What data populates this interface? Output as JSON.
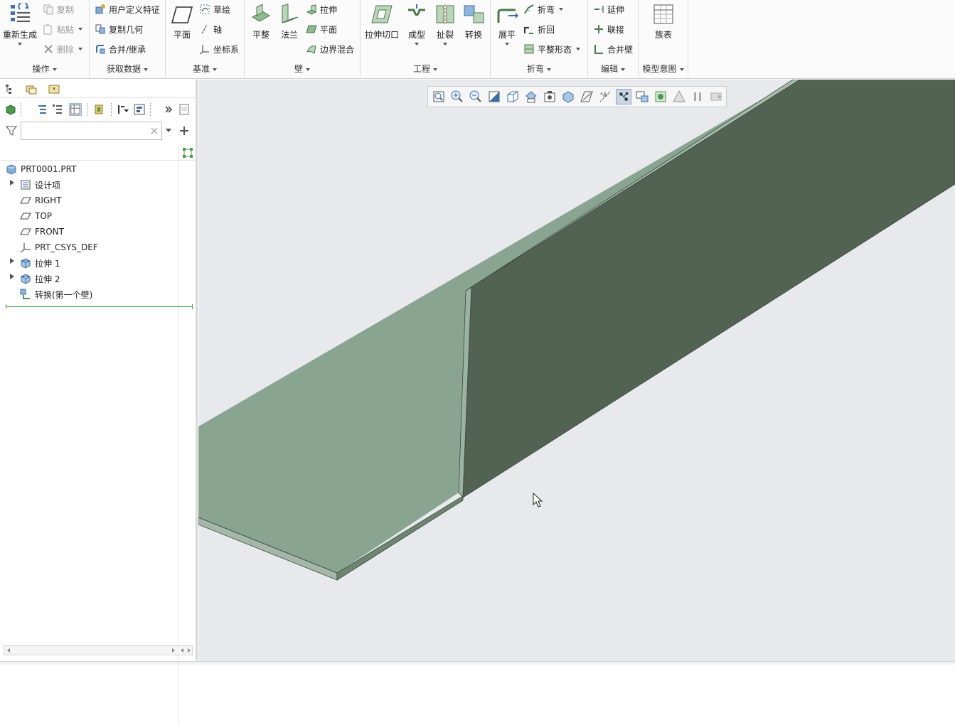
{
  "ribbon": {
    "groups": {
      "operations": "操作",
      "get_data": "获取数据",
      "datum": "基准",
      "wall": "壁",
      "engineering": "工程",
      "bend": "折弯",
      "edit": "编辑",
      "model_intent": "模型意图"
    },
    "regenerate": "重新生成",
    "copy": "复制",
    "paste": "粘贴",
    "delete": "删除",
    "user_defined_feature": "用户定义特征",
    "copy_geometry": "复制几何",
    "merge_inherit": "合并/继承",
    "plane": "平面",
    "sketch": "草绘",
    "axis": "轴",
    "csys": "坐标系",
    "flat": "平整",
    "flange": "法兰",
    "extrude": "拉伸",
    "planar": "平面",
    "boundary_blend": "边界混合",
    "extrude_cut": "拉伸切口",
    "form": "成型",
    "rip": "扯裂",
    "convert": "转换",
    "unbend": "展平",
    "bend": "折弯",
    "bend_back": "折回",
    "flat_pattern": "平整形态",
    "extend": "延伸",
    "join": "联接",
    "merge_walls": "合并壁",
    "family_table": "族表"
  },
  "model_tree": {
    "search_value": "",
    "root": "PRT0001.PRT",
    "items": [
      {
        "label": "设计项",
        "icon": "design-items-icon",
        "expandable": true
      },
      {
        "label": "RIGHT",
        "icon": "datum-plane-icon",
        "expandable": false
      },
      {
        "label": "TOP",
        "icon": "datum-plane-icon",
        "expandable": false
      },
      {
        "label": "FRONT",
        "icon": "datum-plane-icon",
        "expandable": false
      },
      {
        "label": "PRT_CSYS_DEF",
        "icon": "csys-icon",
        "expandable": false
      },
      {
        "label": "拉伸 1",
        "icon": "extrude-feature-icon",
        "expandable": true
      },
      {
        "label": "拉伸 2",
        "icon": "extrude-feature-icon",
        "expandable": true
      },
      {
        "label": "转换(第一个壁)",
        "icon": "convert-feature-icon",
        "expandable": false
      }
    ]
  },
  "colors": {
    "face_light": "#89a592",
    "face_dark": "#526253",
    "edge": "#3b4a3d",
    "background": "#e8e9ec"
  }
}
